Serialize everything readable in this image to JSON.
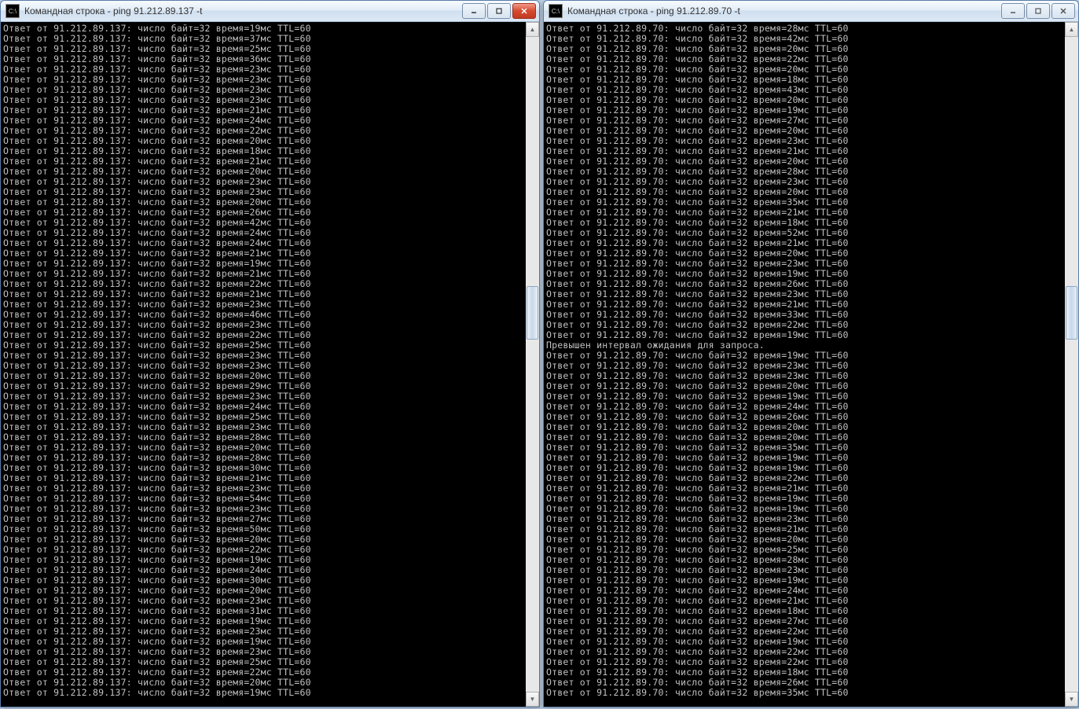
{
  "windows": [
    {
      "id": "left",
      "title": "Командная строка - ping  91.212.89.137 -t",
      "active_close": true,
      "ip": "91.212.89.137",
      "bytes": 32,
      "ttl": 60,
      "lines": [
        {
          "t": 19
        },
        {
          "t": 37
        },
        {
          "t": 25
        },
        {
          "t": 36
        },
        {
          "t": 23
        },
        {
          "t": 23
        },
        {
          "t": 23
        },
        {
          "t": 23
        },
        {
          "t": 21
        },
        {
          "t": 24
        },
        {
          "t": 22
        },
        {
          "t": 20
        },
        {
          "t": 18
        },
        {
          "t": 21
        },
        {
          "t": 20
        },
        {
          "t": 23
        },
        {
          "t": 23
        },
        {
          "t": 20
        },
        {
          "t": 26
        },
        {
          "t": 42
        },
        {
          "t": 24
        },
        {
          "t": 24
        },
        {
          "t": 21
        },
        {
          "t": 19
        },
        {
          "t": 21
        },
        {
          "t": 22
        },
        {
          "t": 21
        },
        {
          "t": 23
        },
        {
          "t": 46
        },
        {
          "t": 23
        },
        {
          "t": 22
        },
        {
          "t": 25
        },
        {
          "t": 23
        },
        {
          "t": 23
        },
        {
          "t": 20
        },
        {
          "t": 29
        },
        {
          "t": 23
        },
        {
          "t": 24
        },
        {
          "t": 25
        },
        {
          "t": 23
        },
        {
          "t": 28
        },
        {
          "t": 20
        },
        {
          "t": 28
        },
        {
          "t": 30
        },
        {
          "t": 21
        },
        {
          "t": 23
        },
        {
          "t": 54
        },
        {
          "t": 23
        },
        {
          "t": 27
        },
        {
          "t": 50
        },
        {
          "t": 20
        },
        {
          "t": 22
        },
        {
          "t": 19
        },
        {
          "t": 24
        },
        {
          "t": 30
        },
        {
          "t": 20
        },
        {
          "t": 23
        },
        {
          "t": 31
        },
        {
          "t": 19
        },
        {
          "t": 23
        },
        {
          "t": 19
        },
        {
          "t": 23
        },
        {
          "t": 25
        },
        {
          "t": 22
        },
        {
          "t": 20
        },
        {
          "t": 19
        }
      ]
    },
    {
      "id": "right",
      "title": "Командная строка - ping  91.212.89.70 -t",
      "active_close": false,
      "ip": "91.212.89.70",
      "bytes": 32,
      "ttl": 60,
      "timeout_text": "Превышен интервал ожидания для запроса.",
      "lines": [
        {
          "t": 28
        },
        {
          "t": 42
        },
        {
          "t": 20
        },
        {
          "t": 22
        },
        {
          "t": 20
        },
        {
          "t": 18
        },
        {
          "t": 43
        },
        {
          "t": 20
        },
        {
          "t": 19
        },
        {
          "t": 27
        },
        {
          "t": 20
        },
        {
          "t": 23
        },
        {
          "t": 21
        },
        {
          "t": 20
        },
        {
          "t": 28
        },
        {
          "t": 23
        },
        {
          "t": 20
        },
        {
          "t": 35
        },
        {
          "t": 21
        },
        {
          "t": 18
        },
        {
          "t": 52
        },
        {
          "t": 21
        },
        {
          "t": 20
        },
        {
          "t": 23
        },
        {
          "t": 19
        },
        {
          "t": 26
        },
        {
          "t": 23
        },
        {
          "t": 21
        },
        {
          "t": 33
        },
        {
          "t": 22
        },
        {
          "t": 19
        },
        {
          "timeout": true
        },
        {
          "t": 19
        },
        {
          "t": 23
        },
        {
          "t": 23
        },
        {
          "t": 20
        },
        {
          "t": 19
        },
        {
          "t": 24
        },
        {
          "t": 26
        },
        {
          "t": 20
        },
        {
          "t": 20
        },
        {
          "t": 35
        },
        {
          "t": 19
        },
        {
          "t": 19
        },
        {
          "t": 22
        },
        {
          "t": 21
        },
        {
          "t": 19
        },
        {
          "t": 19
        },
        {
          "t": 23
        },
        {
          "t": 21
        },
        {
          "t": 20
        },
        {
          "t": 25
        },
        {
          "t": 28
        },
        {
          "t": 23
        },
        {
          "t": 19
        },
        {
          "t": 24
        },
        {
          "t": 21
        },
        {
          "t": 18
        },
        {
          "t": 27
        },
        {
          "t": 22
        },
        {
          "t": 19
        },
        {
          "t": 22
        },
        {
          "t": 22
        },
        {
          "t": 18
        },
        {
          "t": 26
        },
        {
          "t": 35
        }
      ]
    }
  ],
  "labels": {
    "reply_from": "Ответ от",
    "bytes_label": "число байт",
    "time_label": "время",
    "ttl_label": "TTL",
    "ms_suffix": "мс"
  }
}
